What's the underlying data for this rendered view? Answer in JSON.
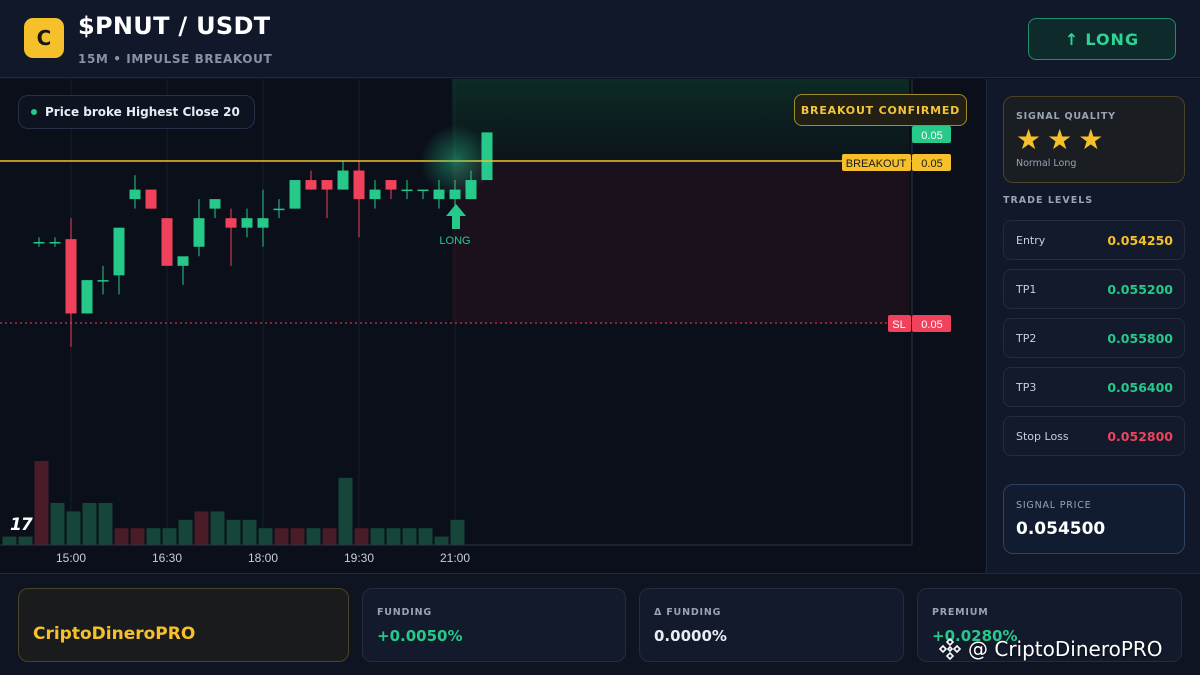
{
  "header": {
    "logo_letter": "C",
    "pair": "$PNUT / USDT",
    "subtitle": "15M • IMPULSE BREAKOUT",
    "direction_arrow": "↑",
    "direction_label": "LONG"
  },
  "chart": {
    "signal_note": "Price broke Highest Close 20",
    "breakout_badge": "BREAKOUT CONFIRMED",
    "tradingview_mark": "17",
    "long_marker_label": "LONG",
    "price_tags": {
      "tp_value": "0.05",
      "breakout_label": "BREAKOUT",
      "breakout_value": "0.05",
      "sl_label": "SL",
      "sl_value": "0.05"
    },
    "colors": {
      "up": "#26c98a",
      "down": "#f0425c",
      "breakout": "#f5c02a"
    }
  },
  "chart_data": {
    "type": "candlestick",
    "x_ticks": [
      "15:00",
      "16:30",
      "18:00",
      "19:30",
      "21:00"
    ],
    "candles": [
      {
        "o": 0.05365,
        "h": 0.0537,
        "l": 0.0536,
        "c": 0.05365
      },
      {
        "o": 0.05365,
        "h": 0.0537,
        "l": 0.0536,
        "c": 0.05365
      },
      {
        "o": 0.05368,
        "h": 0.0539,
        "l": 0.05255,
        "c": 0.0529
      },
      {
        "o": 0.0529,
        "h": 0.05325,
        "l": 0.0529,
        "c": 0.05325
      },
      {
        "o": 0.05325,
        "h": 0.0534,
        "l": 0.0531,
        "c": 0.05325
      },
      {
        "o": 0.0533,
        "h": 0.0538,
        "l": 0.0531,
        "c": 0.0538
      },
      {
        "o": 0.0541,
        "h": 0.05435,
        "l": 0.054,
        "c": 0.0542
      },
      {
        "o": 0.0542,
        "h": 0.0542,
        "l": 0.054,
        "c": 0.054
      },
      {
        "o": 0.0539,
        "h": 0.0539,
        "l": 0.0536,
        "c": 0.0534
      },
      {
        "o": 0.0534,
        "h": 0.05345,
        "l": 0.0532,
        "c": 0.0535
      },
      {
        "o": 0.0536,
        "h": 0.0541,
        "l": 0.0535,
        "c": 0.0539
      },
      {
        "o": 0.054,
        "h": 0.0541,
        "l": 0.0539,
        "c": 0.0541
      },
      {
        "o": 0.0539,
        "h": 0.054,
        "l": 0.0534,
        "c": 0.0538
      },
      {
        "o": 0.0538,
        "h": 0.054,
        "l": 0.0537,
        "c": 0.0539
      },
      {
        "o": 0.0538,
        "h": 0.0542,
        "l": 0.0536,
        "c": 0.0539
      },
      {
        "o": 0.054,
        "h": 0.0541,
        "l": 0.0539,
        "c": 0.054
      },
      {
        "o": 0.054,
        "h": 0.0543,
        "l": 0.054,
        "c": 0.0543
      },
      {
        "o": 0.0543,
        "h": 0.0544,
        "l": 0.0542,
        "c": 0.0542
      },
      {
        "o": 0.0543,
        "h": 0.0543,
        "l": 0.0539,
        "c": 0.0542
      },
      {
        "o": 0.0542,
        "h": 0.0545,
        "l": 0.0542,
        "c": 0.0544
      },
      {
        "o": 0.0544,
        "h": 0.0545,
        "l": 0.0537,
        "c": 0.0541
      },
      {
        "o": 0.0541,
        "h": 0.0543,
        "l": 0.054,
        "c": 0.0542
      },
      {
        "o": 0.0543,
        "h": 0.0543,
        "l": 0.0541,
        "c": 0.0542
      },
      {
        "o": 0.0542,
        "h": 0.0543,
        "l": 0.0541,
        "c": 0.0542
      },
      {
        "o": 0.0542,
        "h": 0.0542,
        "l": 0.0541,
        "c": 0.0542
      },
      {
        "o": 0.0541,
        "h": 0.0543,
        "l": 0.054,
        "c": 0.0542
      },
      {
        "o": 0.0541,
        "h": 0.0543,
        "l": 0.054,
        "c": 0.0542
      },
      {
        "o": 0.0541,
        "h": 0.0544,
        "l": 0.0541,
        "c": 0.0543
      },
      {
        "o": 0.0543,
        "h": 0.0548,
        "l": 0.0543,
        "c": 0.0548
      }
    ],
    "volumes": [
      1,
      1,
      10,
      5,
      4,
      5,
      5,
      2,
      2,
      2,
      2,
      3,
      4,
      4,
      3,
      3,
      2,
      2,
      2,
      2,
      2,
      8,
      2,
      2,
      2,
      2,
      2,
      1,
      3
    ]
  },
  "sidebar": {
    "quality_title": "SIGNAL QUALITY",
    "stars": [
      "★",
      "★",
      "★"
    ],
    "quality_sub": "Normal Long",
    "levels_title": "TRADE LEVELS",
    "levels": [
      {
        "name": "Entry",
        "value": "0.054250",
        "color": "#f5c02a"
      },
      {
        "name": "TP1",
        "value": "0.055200",
        "color": "#26c98a"
      },
      {
        "name": "TP2",
        "value": "0.055800",
        "color": "#26c98a"
      },
      {
        "name": "TP3",
        "value": "0.056400",
        "color": "#26c98a"
      },
      {
        "name": "Stop Loss",
        "value": "0.052800",
        "color": "#f0425c"
      }
    ],
    "signal_price_title": "SIGNAL PRICE",
    "signal_price_value": "0.054500"
  },
  "bottom": {
    "brand": "CriptoDineroPRO",
    "stats": [
      {
        "label": "FUNDING",
        "value": "+0.0050%",
        "color": "#26c98a"
      },
      {
        "label": "Δ FUNDING",
        "value": "0.0000%",
        "color": "#e8ecf4"
      },
      {
        "label": "PREMIUM",
        "value": "+0.0280%",
        "color": "#26c98a"
      }
    ]
  },
  "watermark": "@ CriptoDineroPRO"
}
